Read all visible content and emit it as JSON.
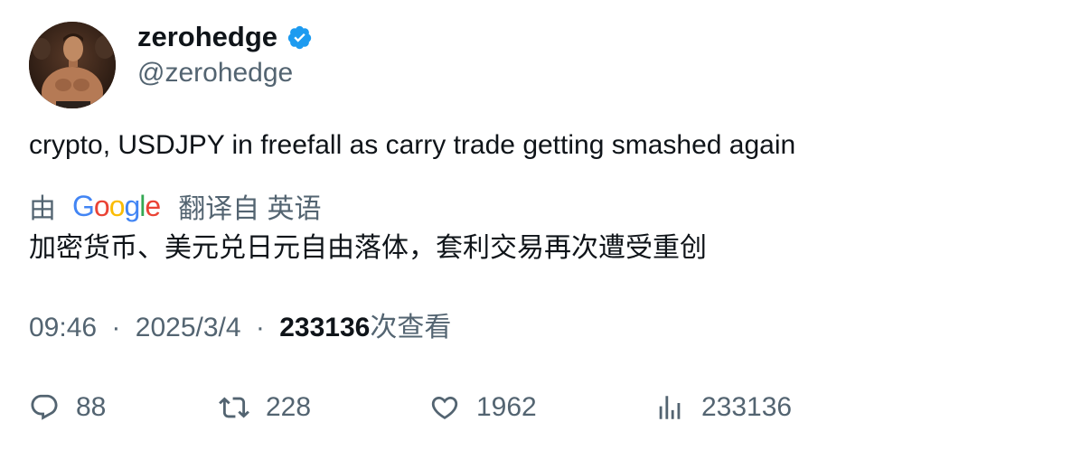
{
  "user": {
    "display_name": "zerohedge",
    "handle": "@zerohedge",
    "verified": true,
    "verified_color": "#1d9bf0"
  },
  "tweet": {
    "text": "crypto, USDJPY in freefall as carry trade getting smashed again"
  },
  "translation": {
    "prefix": "由",
    "logo_text": "Google",
    "logo_letter_colors": [
      "#4285f4",
      "#ea4335",
      "#fbbc05",
      "#4285f4",
      "#34a853",
      "#ea4335"
    ],
    "suffix": "翻译自 英语",
    "text": "加密货币、美元兑日元自由落体，套利交易再次遭受重创"
  },
  "meta": {
    "time": "09:46",
    "separator": "·",
    "date": "2025/3/4",
    "views_count": "233136",
    "views_label": "次查看"
  },
  "actions": {
    "replies": "88",
    "retweets": "228",
    "likes": "1962",
    "views": "233136"
  },
  "colors": {
    "text_primary": "#0f1419",
    "text_secondary": "#536471"
  }
}
